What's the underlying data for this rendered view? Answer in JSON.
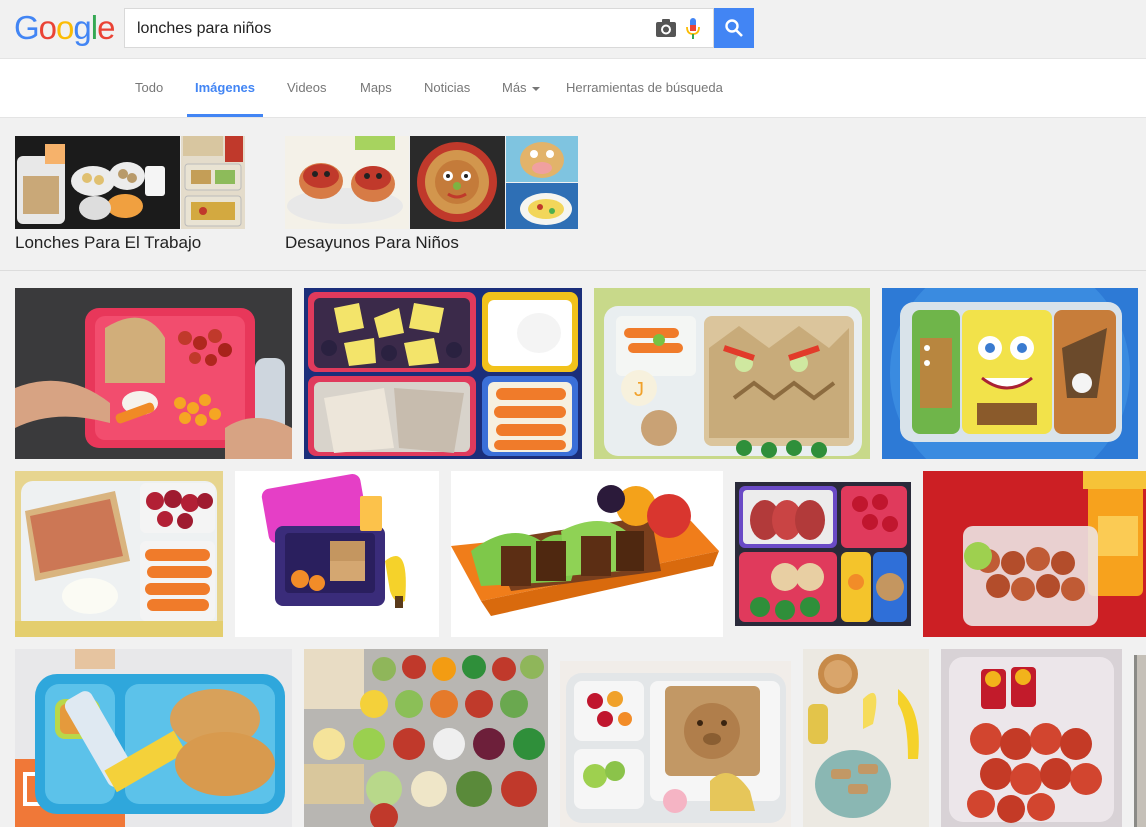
{
  "logo": {
    "letters": [
      "G",
      "o",
      "o",
      "g",
      "l",
      "e"
    ],
    "colors": [
      "#4285f4",
      "#ea4335",
      "#fbbc05",
      "#4285f4",
      "#34a853",
      "#ea4335"
    ]
  },
  "search": {
    "query": "lonches para niños",
    "camera_icon": "camera-icon",
    "mic_icon": "microphone-icon",
    "button_icon": "magnifier-icon",
    "button_color": "#4285f4"
  },
  "tabs": [
    {
      "label": "Todo",
      "active": false
    },
    {
      "label": "Imágenes",
      "active": true
    },
    {
      "label": "Videos",
      "active": false
    },
    {
      "label": "Maps",
      "active": false
    },
    {
      "label": "Noticias",
      "active": false
    },
    {
      "label": "Más",
      "active": false
    },
    {
      "label": "Herramientas de búsqueda",
      "active": false
    }
  ],
  "related": [
    {
      "caption": "Lonches Para El Trabajo"
    },
    {
      "caption": "Desayunos Para Niños"
    }
  ],
  "results_count_rows": 3
}
